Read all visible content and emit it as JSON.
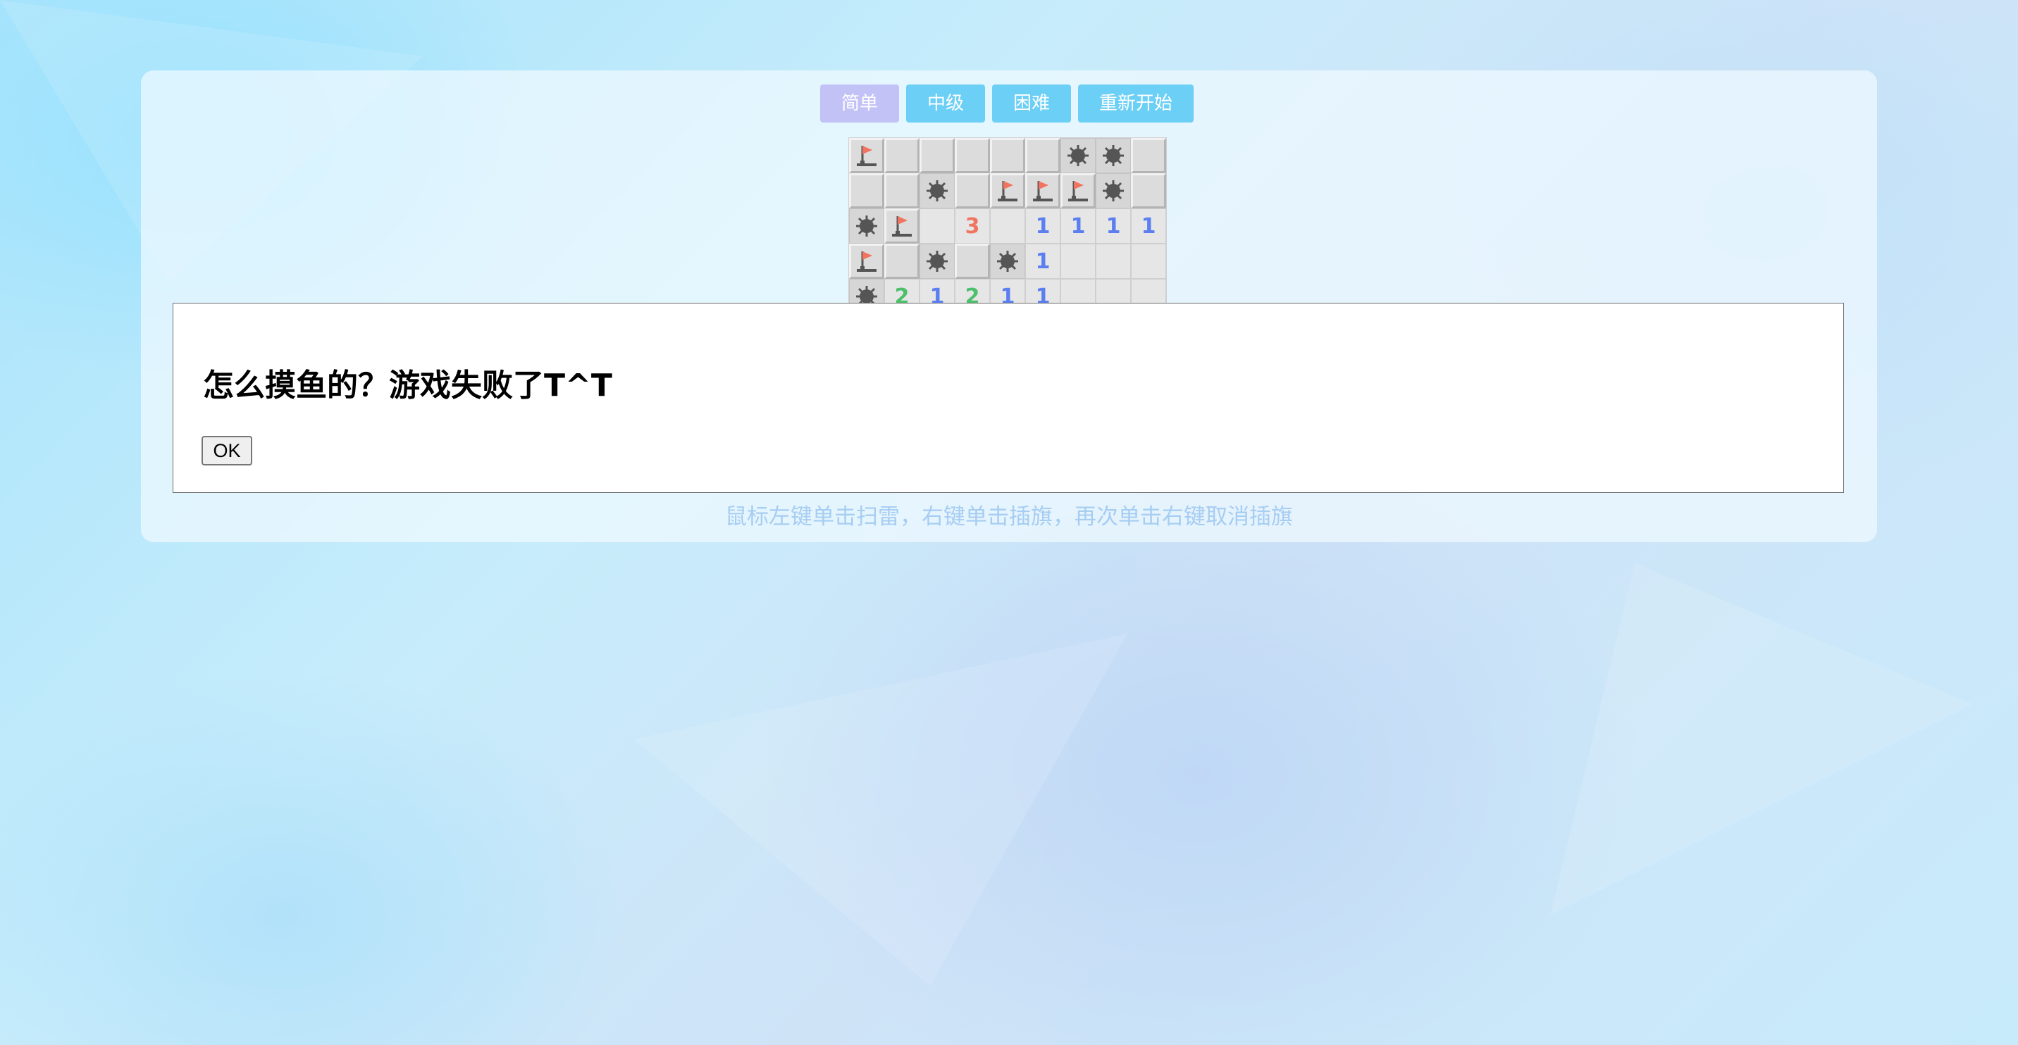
{
  "levels": [
    {
      "label": "简单",
      "active": true
    },
    {
      "label": "中级",
      "active": false
    },
    {
      "label": "困难",
      "active": false
    },
    {
      "label": "重新开始",
      "active": false
    }
  ],
  "board": {
    "rows": [
      [
        "F",
        "C",
        "C",
        "C",
        "C",
        "C",
        "M",
        "M",
        "C"
      ],
      [
        "C",
        "C",
        "M",
        "C",
        "F",
        "F",
        "F",
        "M",
        "C"
      ],
      [
        "M",
        "F",
        "O",
        "3",
        "O",
        "1",
        "1",
        "1",
        "1"
      ],
      [
        "F",
        "C",
        "M",
        "C",
        "M",
        "1",
        "O",
        "O",
        "O"
      ],
      [
        "M",
        "2",
        "1",
        "2",
        "1",
        "1",
        "O",
        "O",
        "O"
      ]
    ]
  },
  "footer": {
    "hint": "鼠标左键单击扫雷，右键单击插旗，再次单击右键取消插旗"
  },
  "dialog": {
    "message": "怎么摸鱼的？游戏失败了T^T",
    "ok_label": "OK"
  },
  "colors": {
    "button": "#6ccff6",
    "button_active": "#c3c2f7",
    "number_1": "#5b7ff0",
    "number_2": "#4cc06a",
    "number_3": "#f0745f",
    "flag": "#f0745f",
    "mine": "#555555"
  },
  "icons": {
    "flag": "flag-icon",
    "mine": "mine-icon"
  }
}
